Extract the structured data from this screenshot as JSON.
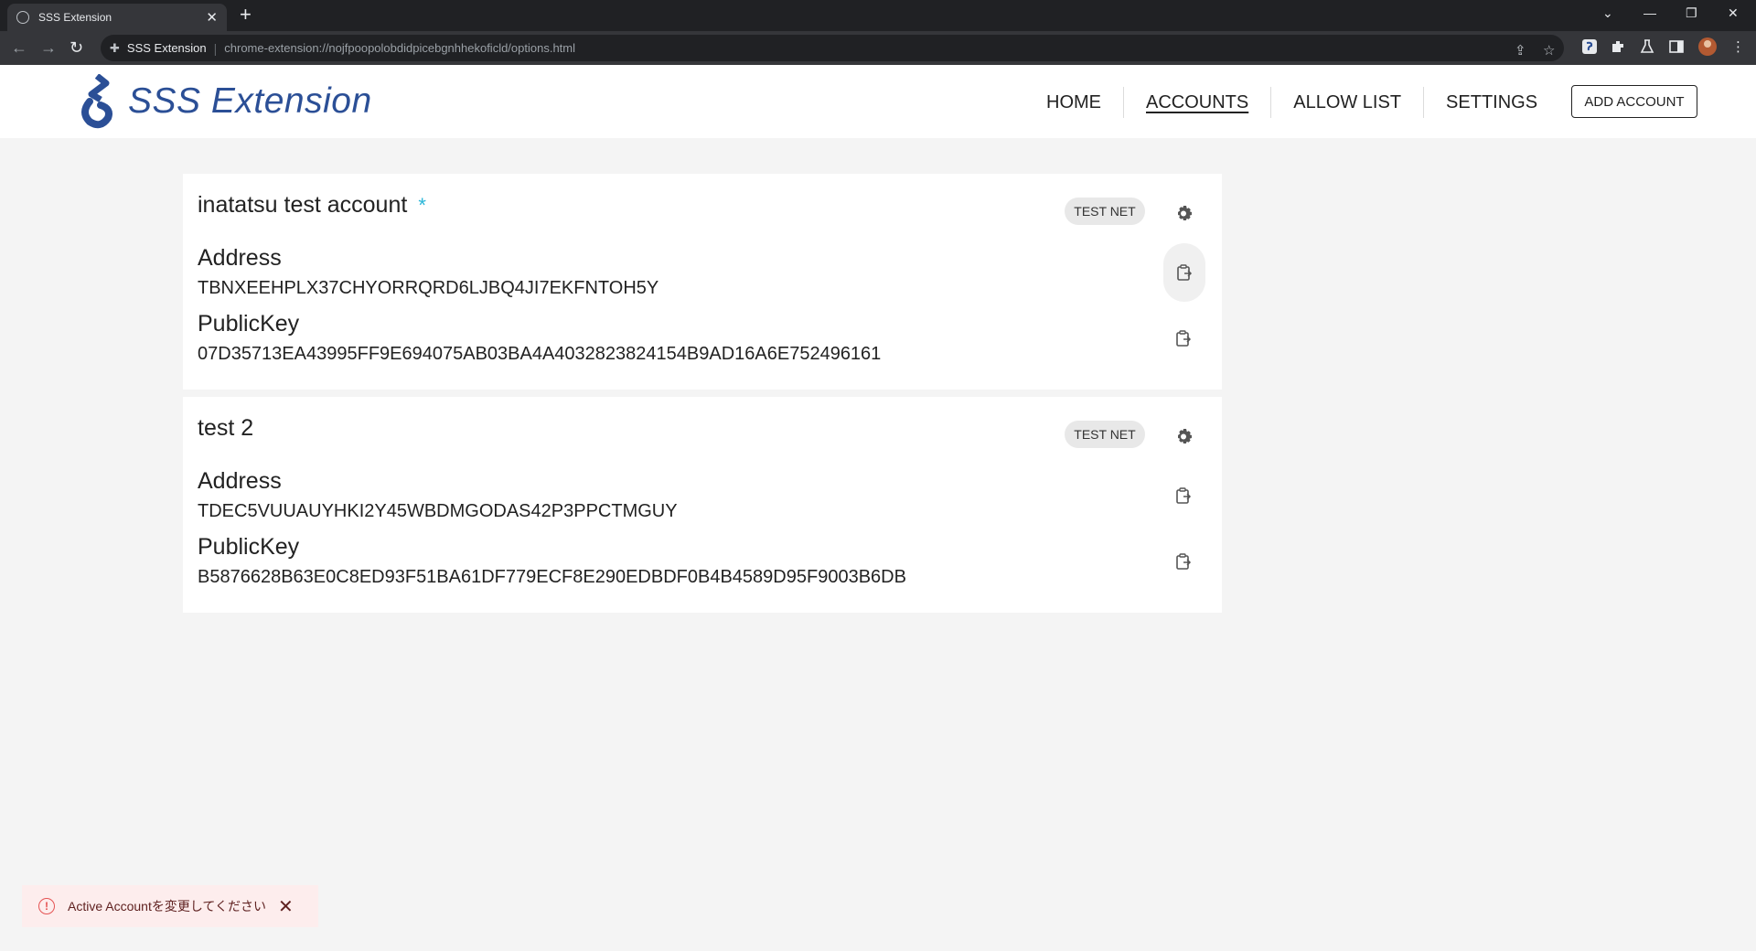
{
  "browser": {
    "tab_title": "SSS Extension",
    "tab_close": "✕",
    "new_tab": "+",
    "site_name": "SSS Extension",
    "url": "chrome-extension://nojfpoopolobdidpicebgnhhekoficld/options.html",
    "window_controls": [
      "⌄",
      "—",
      "❐",
      "✕"
    ]
  },
  "app": {
    "logo_text": "SSS Extension",
    "nav": [
      "HOME",
      "ACCOUNTS",
      "ALLOW LIST",
      "SETTINGS"
    ],
    "active_nav": "ACCOUNTS",
    "add_account_label": "ADD ACCOUNT",
    "accent_color": "#2b4f96"
  },
  "accounts": [
    {
      "name": "inatatsu test account",
      "active_marker": "*",
      "network": "TEST NET",
      "address_label": "Address",
      "address": "TBNXEEHPLX37CHYORRQRD6LJBQ4JI7EKFNTOH5Y",
      "publickey_label": "PublicKey",
      "publickey": "07D35713EA43995FF9E694075AB03BA4A4032823824154B9AD16A6E752496161"
    },
    {
      "name": "test 2",
      "network": "TEST NET",
      "address_label": "Address",
      "address": "TDEC5VUUAUYHKI2Y45WBDMGODAS42P3PPCTMGUY",
      "publickey_label": "PublicKey",
      "publickey": "B5876628B63E0C8ED93F51BA61DF779ECF8E290EDBDF0B4B4589D95F9003B6DB"
    }
  ],
  "toast": {
    "message": "Active Accountを変更してください",
    "icon": "!",
    "close": "✕"
  }
}
